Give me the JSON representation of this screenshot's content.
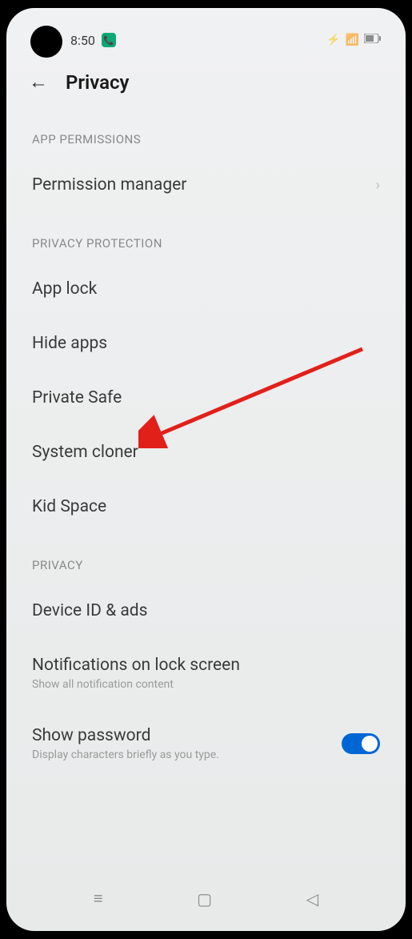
{
  "statusBar": {
    "time": "8:50"
  },
  "header": {
    "title": "Privacy"
  },
  "sections": {
    "appPermissions": {
      "header": "APP PERMISSIONS",
      "items": {
        "permissionManager": "Permission manager"
      }
    },
    "privacyProtection": {
      "header": "PRIVACY PROTECTION",
      "items": {
        "appLock": "App lock",
        "hideApps": "Hide apps",
        "privateSafe": "Private Safe",
        "systemCloner": "System cloner",
        "kidSpace": "Kid Space"
      }
    },
    "privacy": {
      "header": "PRIVACY",
      "items": {
        "deviceId": {
          "title": "Device ID & ads"
        },
        "notifications": {
          "title": "Notifications on lock screen",
          "subtitle": "Show all notification content"
        },
        "showPassword": {
          "title": "Show password",
          "subtitle": "Display characters briefly as you type.",
          "toggle": true
        }
      }
    }
  }
}
